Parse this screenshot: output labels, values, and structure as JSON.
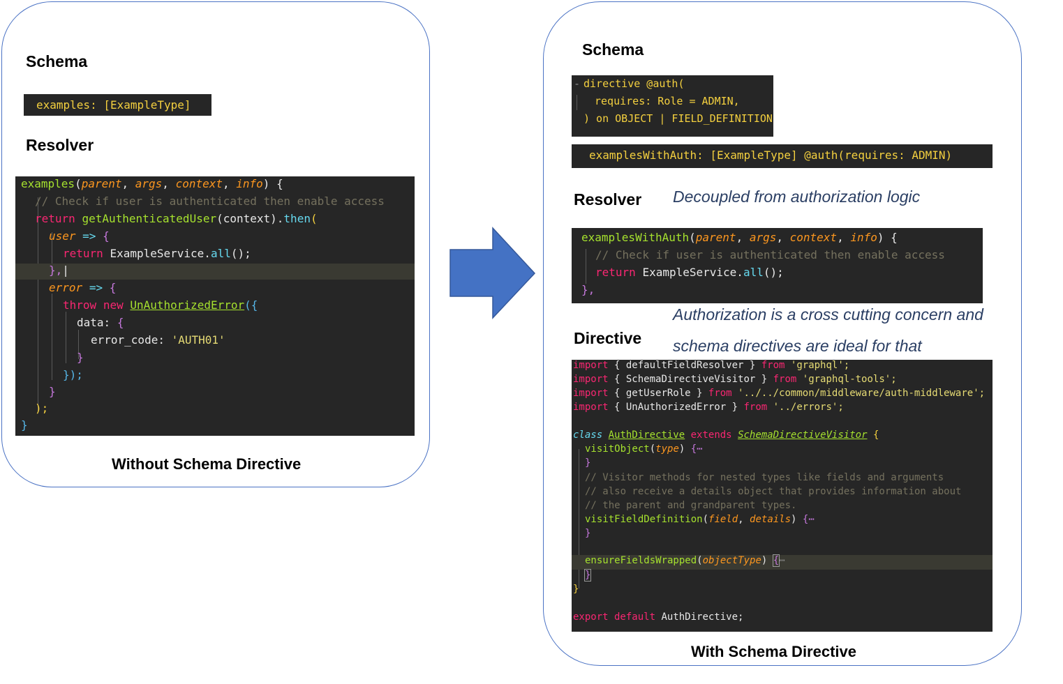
{
  "left": {
    "schema_heading": "Schema",
    "resolver_heading": "Resolver",
    "caption": "Without Schema Directive",
    "schema_code": "examples: [ExampleType]",
    "resolver_code": {
      "l1_name": "examples",
      "l1_paren": "(",
      "l1_p1": "parent",
      "l1_p2": "args",
      "l1_p3": "context",
      "l1_p4": "info",
      "l1_end": ") {",
      "l2": "// Check if user is authenticated then enable access",
      "l3_return": "return",
      "l3_fn": "getAuthenticatedUser",
      "l3_arg": "(context).",
      "l3_then": "then",
      "l3_end": "(",
      "l4_param": "user",
      "l4_arrow": "=>",
      "l4_brace": "{",
      "l5_return": "return",
      "l5_obj": "ExampleService.",
      "l5_m": "all",
      "l5_end": "();",
      "l6": "},",
      "l7_param": "error",
      "l7_arrow": "=>",
      "l7_brace": "{",
      "l8_throw": "throw",
      "l8_new": "new",
      "l8_cls": "UnAuthorizedError",
      "l8_end": "({",
      "l9_key": "data:",
      "l9_brace": "{",
      "l10_key": "error_code:",
      "l10_val": "'AUTH01'",
      "l11": "}",
      "l12": "});",
      "l13": "}",
      "l14": ");",
      "l15": "}"
    }
  },
  "right": {
    "schema_heading": "Schema",
    "resolver_heading": "Resolver",
    "directive_heading": "Directive",
    "caption": "With Schema Directive",
    "note_resolver": "Decoupled from authorization logic",
    "note_directive_1": "Authorization is a cross cutting concern and",
    "note_directive_2": "schema directives are ideal for that",
    "directive_def": {
      "l1": "directive @auth(",
      "l2": "requires: Role = ADMIN,",
      "l3": ") on OBJECT | FIELD_DEFINITION"
    },
    "schema_field": "examplesWithAuth: [ExampleType] @auth(requires: ADMIN)",
    "resolver_code": {
      "l1_name": "examplesWithAuth",
      "l1_paren": "(",
      "l1_p1": "parent",
      "l1_p2": "args",
      "l1_p3": "context",
      "l1_p4": "info",
      "l1_end": ") {",
      "l2": "// Check if user is authenticated then enable access",
      "l3_return": "return",
      "l3_obj": "ExampleService.",
      "l3_m": "all",
      "l3_end": "();",
      "l4": "},"
    },
    "directive_code": {
      "imp": "import",
      "from": "from",
      "i1_name": "{ defaultFieldResolver }",
      "i1_src": "'graphql';",
      "i2_name": "{ SchemaDirectiveVisitor }",
      "i2_src": "'graphql-tools';",
      "i3_name": "{ getUserRole }",
      "i3_src": "'../../common/middleware/auth-middleware';",
      "i4_name": "{ UnAuthorizedError }",
      "i4_src": "'../errors';",
      "cls_kw": "class",
      "cls_name": "AuthDirective",
      "ext_kw": "extends",
      "ext_name": "SchemaDirectiveVisitor",
      "open_brace": "{",
      "vo_name": "visitObject",
      "vo_param": "type",
      "vo_end": "{⋯",
      "close_brace": "}",
      "c1": "// Visitor methods for nested types like fields and arguments",
      "c2": "// also receive a details object that provides information about",
      "c3": "// the parent and grandparent types.",
      "vf_name": "visitFieldDefinition",
      "vf_p1": "field",
      "vf_p2": "details",
      "vf_end": "{⋯",
      "ef_name": "ensureFieldsWrapped",
      "ef_param": "objectType",
      "ef_brace": "{",
      "ef_dots": "⋯",
      "ef_close": "}",
      "class_close": "}",
      "exp_kw": "export default",
      "exp_name": "AuthDirective;"
    }
  },
  "colors": {
    "panel_border": "#4a72c4",
    "arrow_fill": "#4472c4",
    "code_background": "#262626",
    "note_text": "#2a3e63"
  }
}
